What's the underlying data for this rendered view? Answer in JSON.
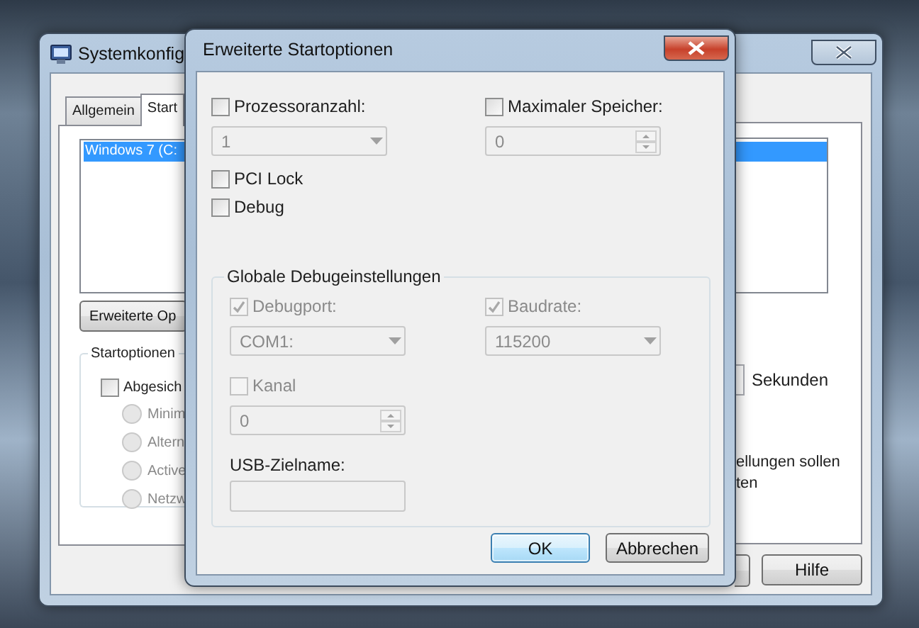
{
  "background_window": {
    "title": "Systemkonfig",
    "tabs": [
      {
        "label": "Allgemein",
        "selected": false
      },
      {
        "label": "Start",
        "selected": true
      }
    ],
    "boot_entries": [
      {
        "label": "Windows 7 (C:",
        "selected": true
      }
    ],
    "advanced_button": "Erweiterte Op",
    "boot_options": {
      "title": "Startoptionen",
      "safe_boot": {
        "label": "Abgesich",
        "checked": false
      },
      "modes": [
        {
          "label": "Minim",
          "selected": false,
          "disabled": true
        },
        {
          "label": "Altern",
          "selected": false,
          "disabled": true
        },
        {
          "label": "Active",
          "selected": false,
          "disabled": true
        },
        {
          "label": "Netzw",
          "selected": false,
          "disabled": true
        }
      ]
    },
    "timeout_unit": "Sekunden",
    "note_lines": [
      "ellungen sollen",
      "ten"
    ],
    "buttons": [
      "Hilfe"
    ]
  },
  "dialog": {
    "title": "Erweiterte Startoptionen",
    "top_options": [
      {
        "label": "Prozessoranzahl:",
        "checked": false,
        "disabled": false,
        "kind": "dropdown",
        "value": "1"
      },
      {
        "label": "Maximaler Speicher:",
        "checked": false,
        "disabled": false,
        "kind": "spinner",
        "value": "0"
      }
    ],
    "flags": [
      {
        "label": "PCI Lock",
        "checked": false
      },
      {
        "label": "Debug",
        "checked": false
      }
    ],
    "debug_settings": {
      "title": "Globale Debugeinstellungen",
      "options": [
        {
          "label": "Debugport:",
          "checked": true,
          "disabled": true,
          "kind": "dropdown",
          "value": "COM1:"
        },
        {
          "label": "Baudrate:",
          "checked": true,
          "disabled": true,
          "kind": "dropdown",
          "value": "115200"
        },
        {
          "label": "Kanal",
          "checked": false,
          "disabled": true,
          "kind": "spinner",
          "value": "0"
        }
      ],
      "usb_target": {
        "label": "USB-Zielname:",
        "disabled": true
      }
    },
    "buttons": [
      {
        "label": "OK",
        "default": true
      },
      {
        "label": "Abbrechen",
        "default": false
      }
    ]
  }
}
